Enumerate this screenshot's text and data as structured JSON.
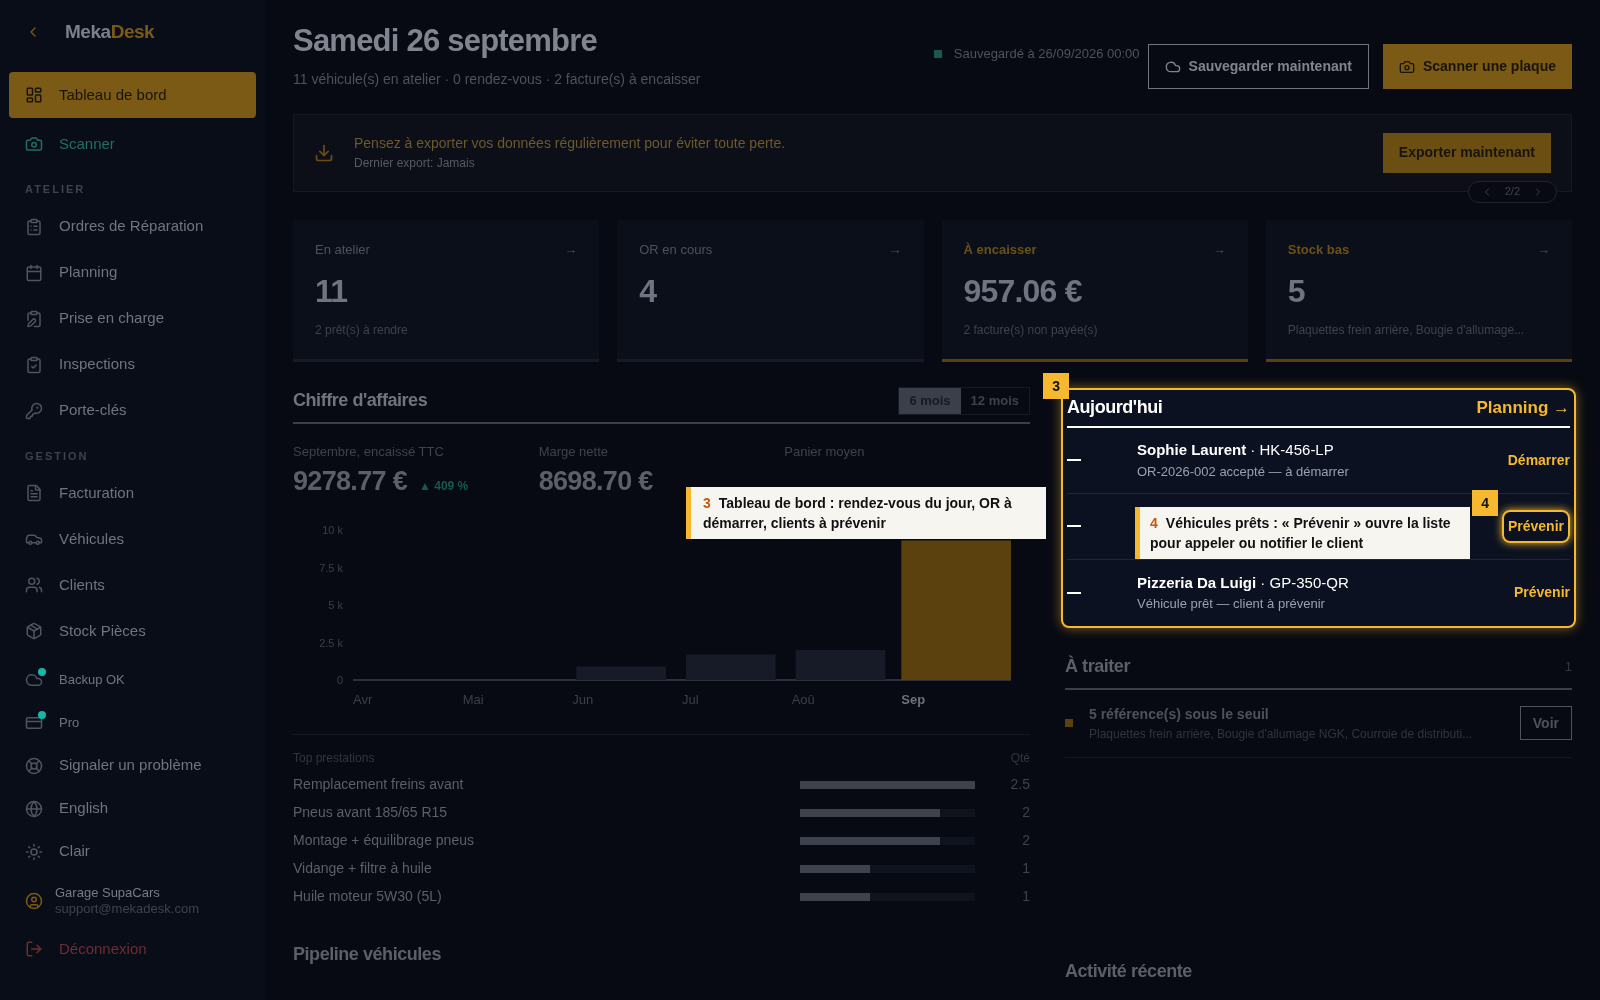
{
  "brand": {
    "part1": "Meka",
    "part2": "Desk"
  },
  "sidebar": {
    "top_items": [
      {
        "label": "Tableau de bord",
        "selected": true,
        "kind": "main"
      },
      {
        "label": "Scanner",
        "selected": false,
        "kind": "scanner"
      }
    ],
    "sections": [
      {
        "title": "ATELIER",
        "items": [
          {
            "label": "Ordres de Réparation",
            "selected": false
          },
          {
            "label": "Planning",
            "selected": false
          },
          {
            "label": "Prise en charge",
            "selected": false
          },
          {
            "label": "Inspections",
            "selected": false
          },
          {
            "label": "Porte-clés",
            "selected": false
          }
        ]
      },
      {
        "title": "GESTION",
        "items": [
          {
            "label": "Facturation",
            "selected": false
          },
          {
            "label": "Véhicules",
            "selected": false
          },
          {
            "label": "Clients",
            "selected": false
          },
          {
            "label": "Stock Pièces",
            "selected": false
          }
        ]
      }
    ],
    "footer_items": [
      {
        "label": "Backup OK",
        "color": "#14b8a6"
      },
      {
        "label": "Pro",
        "color": "#14b8a6"
      },
      {
        "label": "Signaler un problème"
      },
      {
        "label": "English"
      },
      {
        "label": "Clair"
      }
    ],
    "account": {
      "name": "Garage SupaCars",
      "email": "support@mekadesk.com"
    },
    "logout": "Déconnexion"
  },
  "header": {
    "title": "Samedi 26 septembre",
    "subtitle": "11 véhicule(s) en atelier · 0 rendez-vous · 2 facture(s) à encaisser",
    "saved": "Sauvegardé à 26/09/2026 00:00",
    "save_button": "Sauvegarder maintenant",
    "scan_button": "Scanner une plaque"
  },
  "banner": {
    "message": "Pensez à exporter vos données régulièrement pour éviter toute perte.",
    "detail": "Dernier export: Jamais",
    "button": "Exporter maintenant",
    "pager": "2/2"
  },
  "kpis": [
    {
      "label": "En atelier",
      "arrow": "→",
      "value": "11",
      "note": "2 prêt(s) à rendre",
      "alert": false
    },
    {
      "label": "OR en cours",
      "arrow": "→",
      "value": "4",
      "alert": false
    },
    {
      "label": "À encaisser",
      "arrow": "→",
      "value": "957.06 €",
      "note": "2 facture(s) non payée(s)",
      "alert": true
    },
    {
      "label": "Stock bas",
      "arrow": "→",
      "value": "5",
      "note": "Plaquettes frein arrière, Bougie d'allumage...",
      "alert": true
    }
  ],
  "revenue": {
    "title": "Chiffre d'affaires",
    "ranges": [
      {
        "label": "6 mois",
        "selected": true
      },
      {
        "label": "12 mois",
        "selected": false
      }
    ],
    "stats": [
      {
        "label": "Septembre, encaissé TTC",
        "value": "9278.77 €",
        "trend": "▲ 409 %"
      },
      {
        "label": "Marge nette",
        "value": "8698.70 €"
      },
      {
        "label": "Panier moyen"
      }
    ],
    "chart_data": {
      "type": "bar",
      "categories": [
        "Avr",
        "Mai",
        "Jun",
        "Jul",
        "Aoû",
        "Sep"
      ],
      "values": [
        0,
        0,
        900,
        1700,
        2000,
        9300
      ],
      "ylim": [
        0,
        10000
      ],
      "yticks": [
        {
          "value": 0,
          "label": "0"
        },
        {
          "value": 2500,
          "label": "2.5 k"
        },
        {
          "value": 5000,
          "label": "5 k"
        },
        {
          "value": 7500,
          "label": "7.5 k"
        },
        {
          "value": 10000,
          "label": "10 k"
        }
      ]
    }
  },
  "top_services": {
    "title": "Top prestations",
    "qty_header": "Qté",
    "rows": [
      {
        "name": "Remplacement freins avant",
        "level": 1,
        "qty": "2.5"
      },
      {
        "name": "Pneus avant 185/65 R15",
        "level": 0.8,
        "qty": "2"
      },
      {
        "name": "Montage + équilibrage pneus",
        "level": 0.8,
        "qty": "2"
      },
      {
        "name": "Vidange + filtre à huile",
        "level": 0.4,
        "qty": "1"
      },
      {
        "name": "Huile moteur 5W30 (5L)",
        "level": 0.4,
        "qty": "1"
      }
    ]
  },
  "today": {
    "title": "Aujourd'hui",
    "link": "Planning →",
    "rows": [
      {
        "name": "Sophie Laurent",
        "plate": "· HK-456-LP",
        "detail": "OR-2026-002 accepté — à démarrer",
        "action": "Démarrer"
      },
      {
        "action": "Prévenir"
      },
      {
        "name": "Pizzeria Da Luigi",
        "plate": "· GP-350-QR",
        "detail": "Véhicule prêt — client à prévenir",
        "action": "Prévenir"
      }
    ]
  },
  "todo": {
    "title": "À traiter",
    "count": "1",
    "items": [
      {
        "title": "5 référence(s) sous le seuil",
        "detail": "Plaquettes frein arrière, Bougie d'allumage NGK, Courroie de distributi...",
        "button": "Voir"
      }
    ]
  },
  "bottom_titles": [
    "Pipeline véhicules",
    "Activité récente"
  ],
  "tour": [
    {
      "badge": "3",
      "step": "3",
      "text": "Tableau de bord : rendez-vous du jour, OR à démarrer, clients à prévenir"
    },
    {
      "badge": "4",
      "step": "4",
      "text": "Véhicules prêts : « Prévenir » ouvre la liste pour appeler ou notifier le client"
    }
  ]
}
